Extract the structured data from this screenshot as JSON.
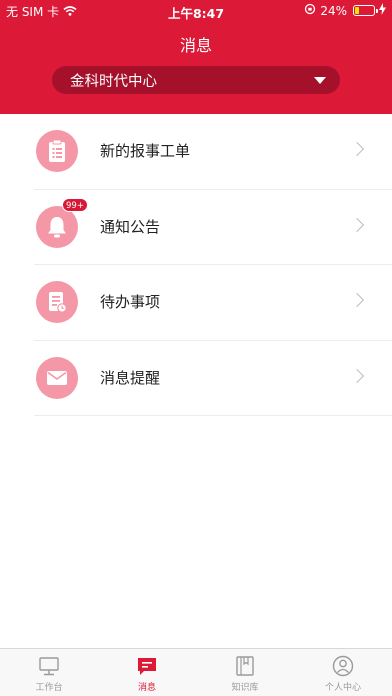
{
  "status_bar": {
    "carrier": "无 SIM 卡",
    "time": "上午8:47",
    "battery": "24%",
    "battery_level": 0.24
  },
  "header": {
    "title": "消息",
    "project_select": {
      "value": "金科时代中心"
    }
  },
  "list": {
    "items": [
      {
        "label": "新的报事工单",
        "icon": "clipboard-icon"
      },
      {
        "label": "通知公告",
        "icon": "bell-icon",
        "badge": "99+"
      },
      {
        "label": "待办事项",
        "icon": "todo-document-icon"
      },
      {
        "label": "消息提醒",
        "icon": "envelope-icon"
      }
    ]
  },
  "tabbar": {
    "items": [
      {
        "label": "工作台",
        "icon": "monitor-icon",
        "active": false
      },
      {
        "label": "消息",
        "icon": "message-icon",
        "active": true
      },
      {
        "label": "知识库",
        "icon": "book-icon",
        "active": false
      },
      {
        "label": "个人中心",
        "icon": "person-icon",
        "active": false
      }
    ]
  },
  "colors": {
    "brand": "#dc1a38",
    "select_bg": "#a5102a",
    "icon_bg": "#f497a6",
    "tab_active": "#dc1a38",
    "tab_inactive": "#9a9a9a"
  }
}
